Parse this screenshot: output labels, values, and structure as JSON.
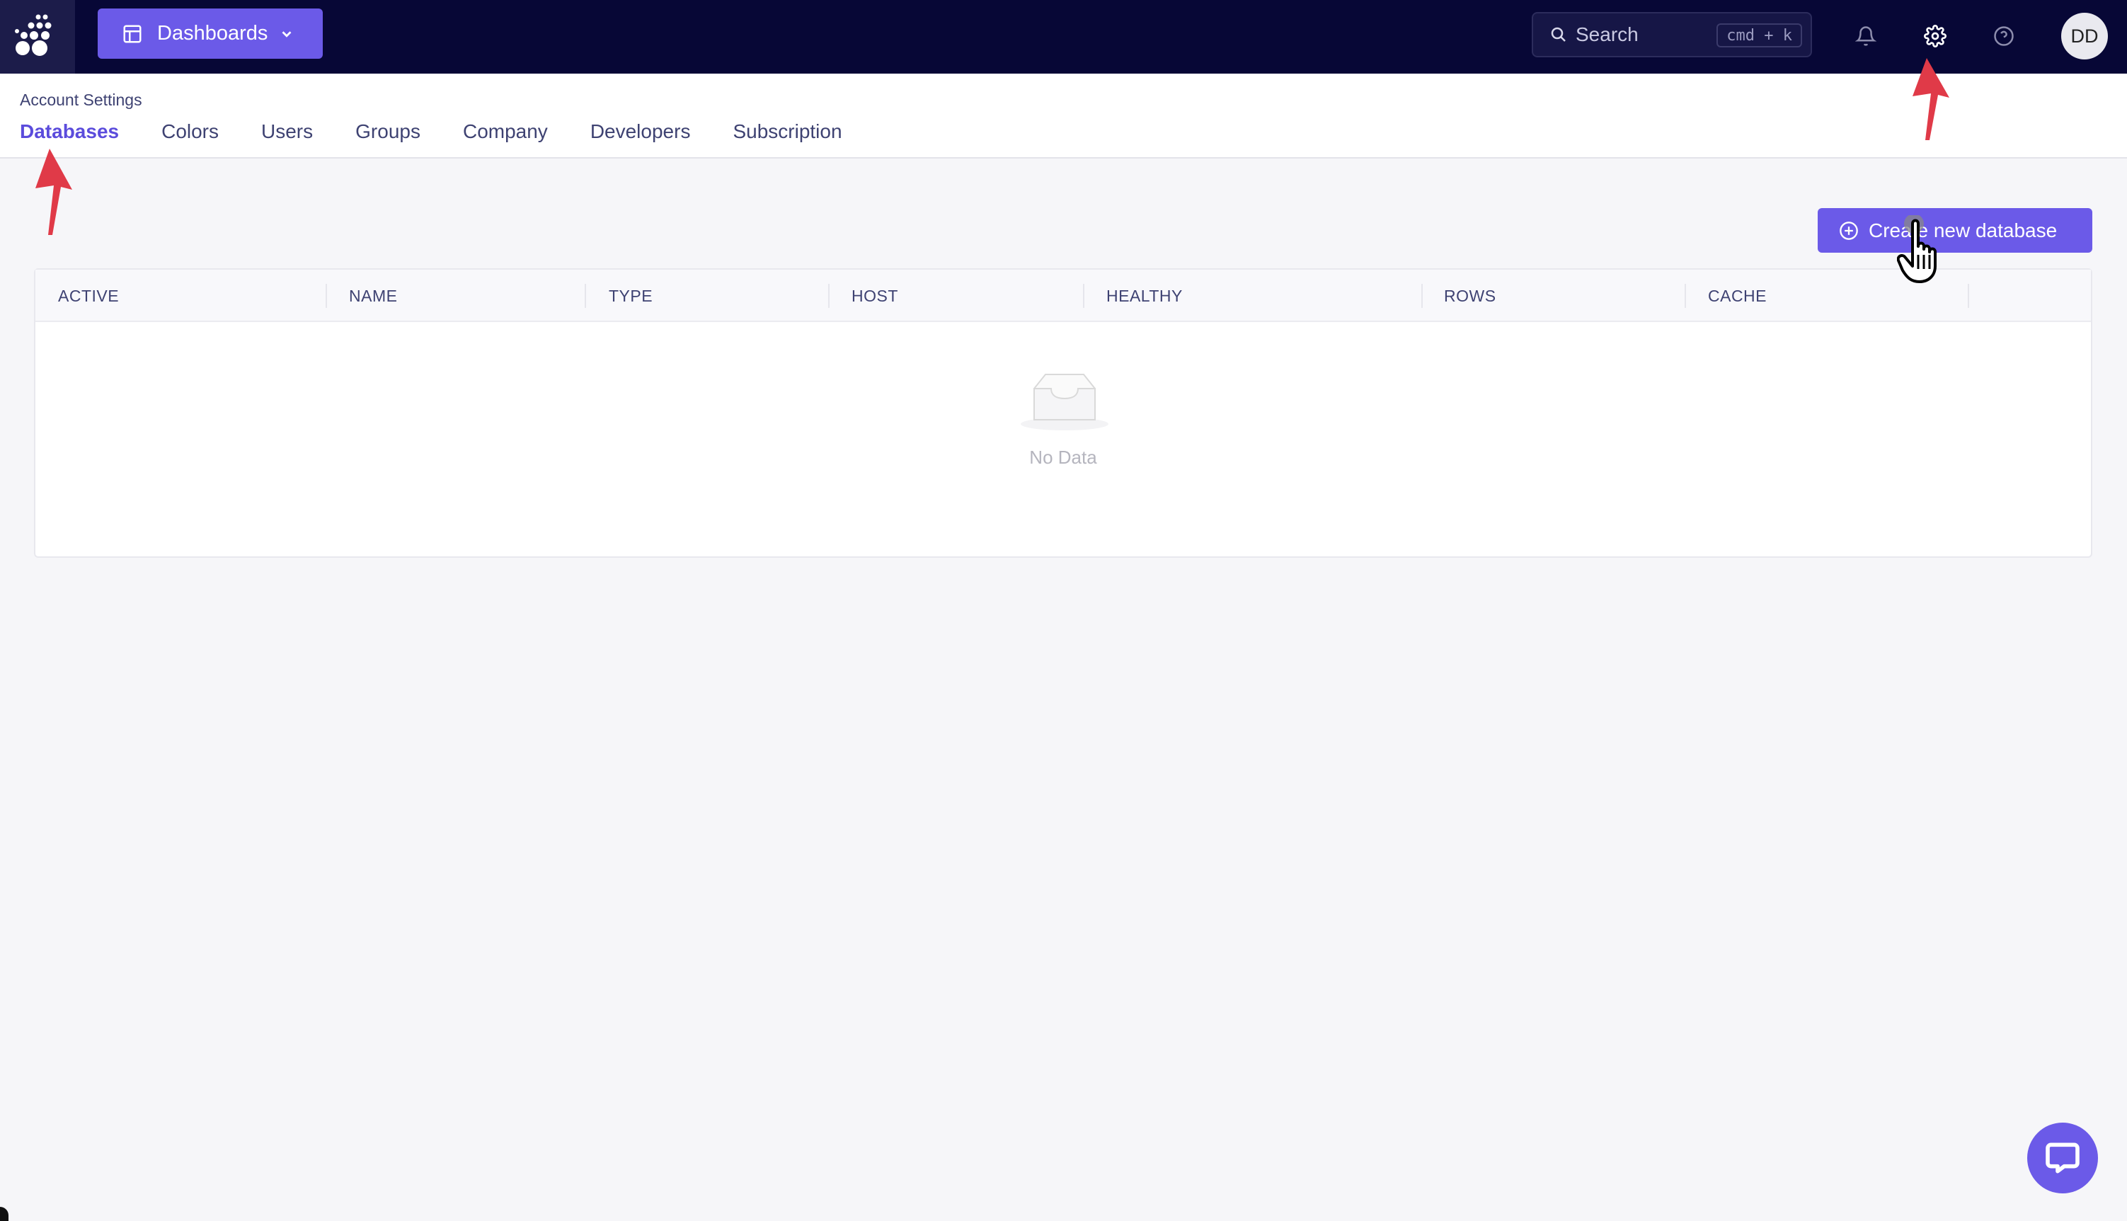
{
  "topbar": {
    "workspace_button": {
      "label": "Dashboards",
      "icon": "layout-grid-icon"
    },
    "search": {
      "placeholder": "Search",
      "shortcut": "cmd + k"
    },
    "icons": [
      "bell-icon",
      "gear-icon",
      "help-circle-icon"
    ],
    "avatar_initials": "DD"
  },
  "settings": {
    "breadcrumb": "Account Settings",
    "tabs": [
      {
        "label": "Databases",
        "active": true
      },
      {
        "label": "Colors",
        "active": false
      },
      {
        "label": "Users",
        "active": false
      },
      {
        "label": "Groups",
        "active": false
      },
      {
        "label": "Company",
        "active": false
      },
      {
        "label": "Developers",
        "active": false
      },
      {
        "label": "Subscription",
        "active": false
      }
    ]
  },
  "content": {
    "create_button_label": "Create new database",
    "table": {
      "columns": [
        "ACTIVE",
        "NAME",
        "TYPE",
        "HOST",
        "HEALTHY",
        "ROWS",
        "CACHE"
      ],
      "rows": [],
      "empty_text": "No Data"
    }
  },
  "colors": {
    "topbar": "#070736",
    "accent": "#6b5ae8",
    "active_tab": "#5b4cdc",
    "annotation_arrow": "#e03a48"
  }
}
